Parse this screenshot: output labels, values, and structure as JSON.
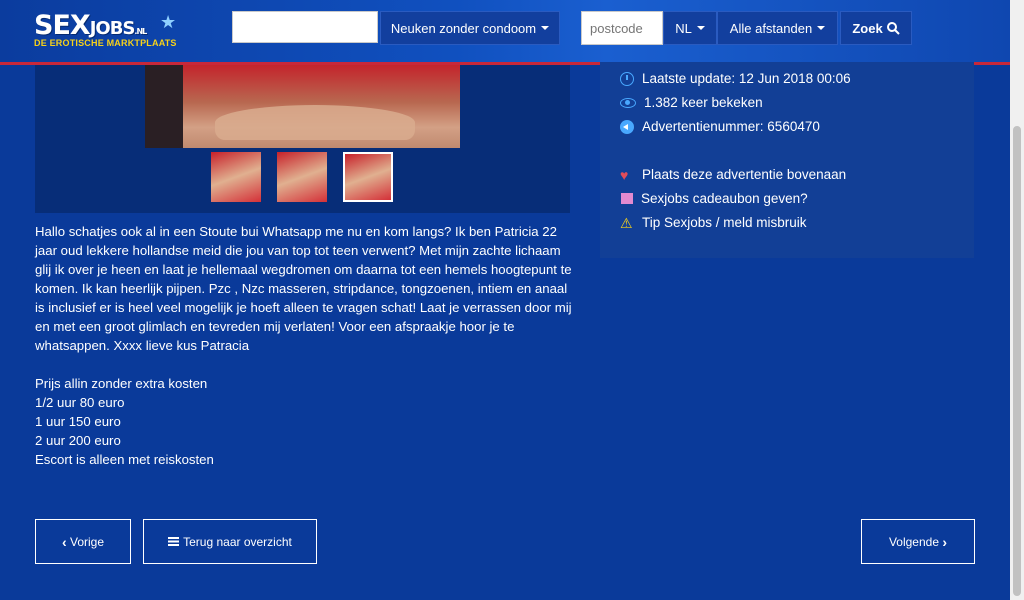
{
  "header": {
    "logo_main": "SEX",
    "logo_jobs": "JOBS",
    "logo_tld": ".NL",
    "logo_tagline": "DE EROTISCHE MARKTPLAATS",
    "search_value": "",
    "category_label": "Neuken zonder condoom",
    "postcode_placeholder": "postcode",
    "country_label": "NL",
    "distance_label": "Alle afstanden",
    "search_button": "Zoek",
    "icons": {
      "search": "search-icon",
      "dropdown": "chevron-down-icon"
    }
  },
  "info": {
    "last_update": "Laatste update: 12 Jun 2018 00:06",
    "views": "1.382 keer bekeken",
    "ad_number": "Advertentienummer: 6560470",
    "promote": "Plaats deze advertentie bovenaan",
    "gift": "Sexjobs cadeaubon geven?",
    "report": "Tip Sexjobs / meld misbruik"
  },
  "description": {
    "text": "Hallo schatjes ook al in een Stoute bui Whatsapp me nu en kom langs? Ik ben Patricia 22 jaar oud lekkere hollandse meid die jou van top tot teen verwent? Met mijn zachte lichaam glij ik over je heen en laat je hellemaal wegdromen om daarna tot een hemels hoogtepunt te komen. Ik kan heerlijk pijpen. Pzc , Nzc masseren, stripdance, tongzoenen, intiem en anaal is inclusief er is heel veel mogelijk je hoeft alleen te vragen schat! Laat je verrassen door mij en met een groot glimlach en tevreden mij verlaten! Voor een afspraakje hoor je te whatsappen. Xxxx lieve kus Patracia",
    "price_lines": [
      "Prijs allin zonder extra kosten",
      "1/2 uur 80 euro",
      "1 uur 150 euro",
      "2 uur 200 euro",
      "Escort is alleen met reiskosten"
    ]
  },
  "nav": {
    "prev": "Vorige",
    "overview": "Terug naar overzicht",
    "next": "Volgende"
  },
  "colors": {
    "background": "#0a3a9a",
    "panel": "#123f96",
    "accent_red": "#c8283a",
    "logo_yellow": "#f7d21a",
    "icon_blue": "#49a8ff"
  }
}
